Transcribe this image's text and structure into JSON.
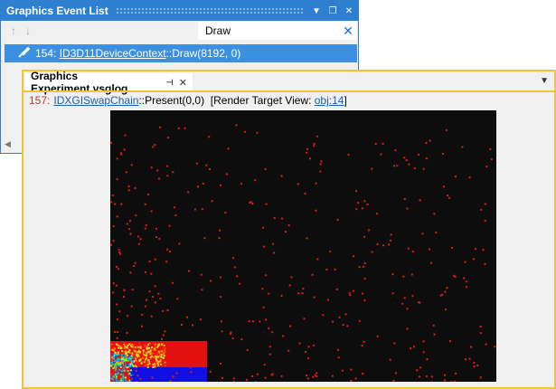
{
  "event_list": {
    "title": "Graphics Event List",
    "search_value": "Draw",
    "row": {
      "number": "154:",
      "class_link": "ID3D11DeviceContext",
      "method": "::Draw(8192, 0)"
    }
  },
  "experiment": {
    "tab_title": "Graphics Experiment.vsglog",
    "info": {
      "number": "157:",
      "class_link": "IDXGISwapChain",
      "method": "::Present(0,0)",
      "rtv_label": "[Render Target View:",
      "rtv_link": "obj:14",
      "rtv_close": "]"
    }
  },
  "colors": {
    "accent_blue": "#2f7fd0",
    "selection_blue": "#3d8fe0",
    "frame_yellow": "#f2c334",
    "render_bg": "#0d0d0d",
    "particle_red": "#e01b1b"
  }
}
